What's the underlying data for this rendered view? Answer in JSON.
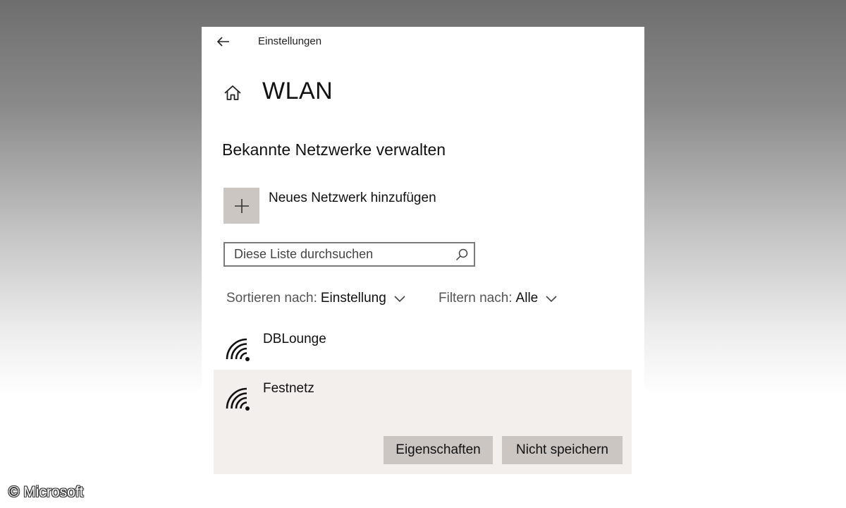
{
  "window": {
    "app_title": "Einstellungen",
    "back_icon": "arrow-left-icon"
  },
  "page": {
    "home_icon": "home-icon",
    "title": "WLAN",
    "section_title": "Bekannte Netzwerke verwalten"
  },
  "add_network": {
    "icon": "plus-icon",
    "label": "Neues Netzwerk hinzufügen"
  },
  "search": {
    "placeholder": "Diese Liste durchsuchen",
    "value": "",
    "icon": "search-icon"
  },
  "sort": {
    "label": "Sortieren nach:",
    "value": "Einstellung"
  },
  "filter": {
    "label": "Filtern nach:",
    "value": "Alle"
  },
  "networks": [
    {
      "name": "DBLounge",
      "icon": "wifi-icon",
      "selected": false
    },
    {
      "name": "Festnetz",
      "icon": "wifi-icon",
      "selected": true
    }
  ],
  "actions": {
    "properties_label": "Eigenschaften",
    "forget_label": "Nicht speichern"
  },
  "colors": {
    "selected_row_bg": "#f3efec",
    "button_bg": "#ccc6c2",
    "window_bg": "#ffffff"
  },
  "watermark": "© Microsoft"
}
